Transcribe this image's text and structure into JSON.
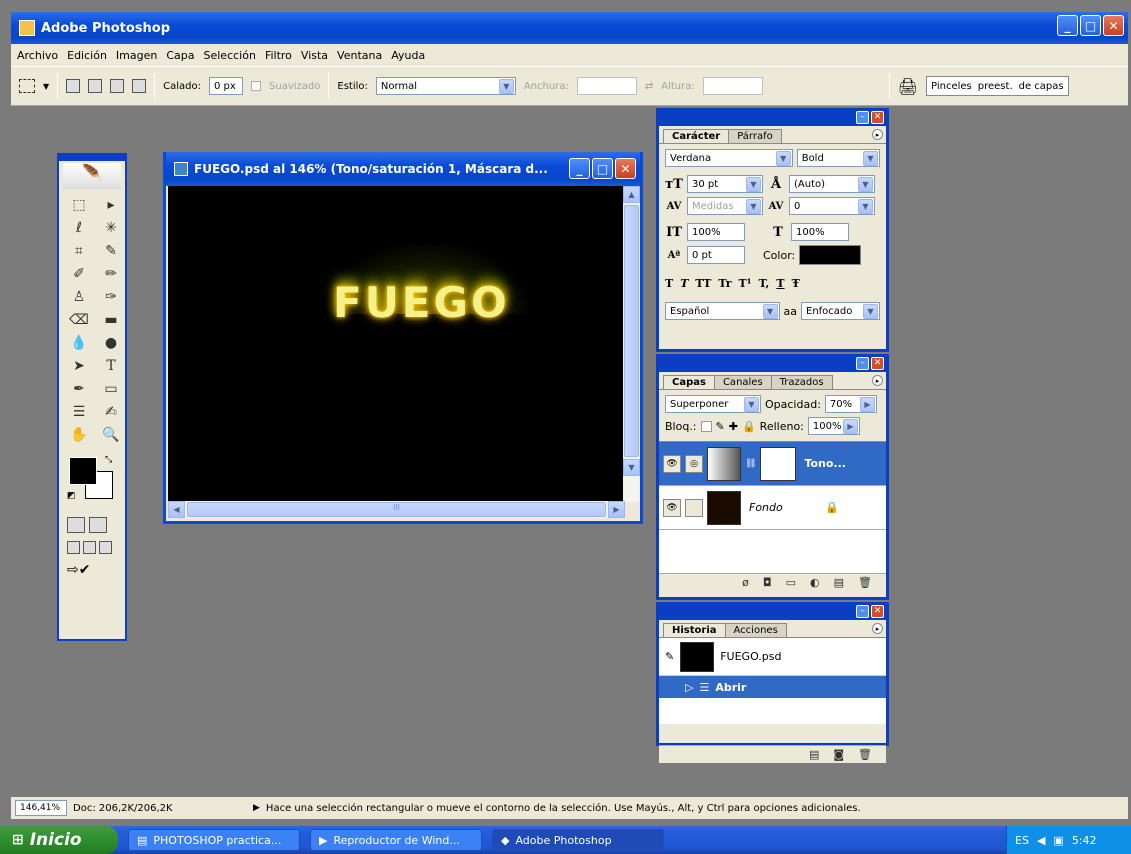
{
  "app": {
    "title": "Adobe Photoshop"
  },
  "menu": [
    "Archivo",
    "Edición",
    "Imagen",
    "Capa",
    "Selección",
    "Filtro",
    "Vista",
    "Ventana",
    "Ayuda"
  ],
  "options": {
    "calado_label": "Calado:",
    "calado_value": "0 px",
    "suavizado": "Suavizado",
    "estilo_label": "Estilo:",
    "estilo_value": "Normal",
    "anchura": "Anchura:",
    "altura": "Altura:",
    "tabs": [
      "Pinceles",
      "preest.",
      "de capas"
    ]
  },
  "document": {
    "title": "FUEGO.psd al 146% (Tono/saturación 1, Máscara d...",
    "text": "FUEGO",
    "scroll_mark": "III"
  },
  "character": {
    "tabs": [
      "Carácter",
      "Párrafo"
    ],
    "font": "Verdana",
    "style": "Bold",
    "size": "30 pt",
    "leading": "(Auto)",
    "kerning": "Medidas",
    "tracking": "0",
    "vscale": "100%",
    "hscale": "100%",
    "baseline": "0 pt",
    "color_label": "Color:",
    "styles": [
      "T",
      "T",
      "TT",
      "Tr",
      "T¹",
      "T,",
      "T",
      "Ŧ"
    ],
    "language": "Español",
    "aa_icon": "aa",
    "antialias": "Enfocado",
    "colors": {
      "text": "#000000"
    }
  },
  "layers": {
    "tabs": [
      "Capas",
      "Canales",
      "Trazados"
    ],
    "blend": "Superponer",
    "opacity_label": "Opacidad:",
    "opacity": "70%",
    "lock_label": "Bloq.:",
    "fill_label": "Relleno:",
    "fill": "100%",
    "items": [
      {
        "name": "Tono..."
      },
      {
        "name": "Fondo"
      }
    ]
  },
  "history": {
    "tabs": [
      "Historia",
      "Acciones"
    ],
    "snapshot": "FUEGO.psd",
    "step": "Abrir"
  },
  "status": {
    "zoom": "146,41%",
    "doc": "Doc: 206,2K/206,2K",
    "hint": "Hace una selección rectangular o mueve el contorno de la selección. Use Mayús., Alt, y Ctrl para opciones adicionales."
  },
  "taskbar": {
    "start": "Inicio",
    "tasks": [
      "PHOTOSHOP practica...",
      "Reproductor de Wind...",
      "Adobe Photoshop"
    ],
    "lang": "ES",
    "time": "5:42"
  }
}
